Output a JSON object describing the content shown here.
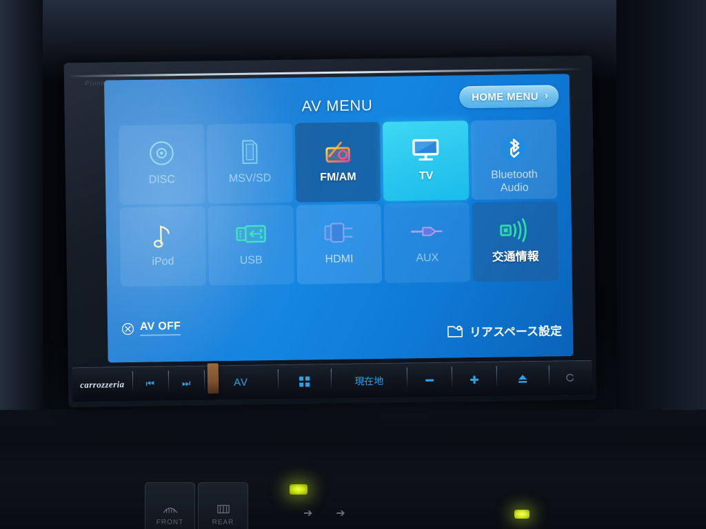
{
  "device": {
    "brand_bezel": "Pioneer",
    "brand_strip": "carrozzeria"
  },
  "screen": {
    "header": {
      "title": "AV MENU",
      "home_menu_label": "HOME MENU",
      "home_menu_arrow": "›"
    },
    "sources": [
      {
        "id": "disc",
        "label": "DISC",
        "icon": "disc-icon",
        "state": "disabled"
      },
      {
        "id": "msv-sd",
        "label": "MSV/SD",
        "icon": "sd-card-icon",
        "state": "disabled"
      },
      {
        "id": "fm-am",
        "label": "FM/AM",
        "icon": "radio-icon",
        "state": "available"
      },
      {
        "id": "tv",
        "label": "TV",
        "icon": "tv-icon",
        "state": "selected"
      },
      {
        "id": "bt-audio",
        "label": "Bluetooth\nAudio",
        "icon": "bluetooth-icon",
        "state": "normal"
      },
      {
        "id": "ipod",
        "label": "iPod",
        "icon": "music-note-icon",
        "state": "disabled"
      },
      {
        "id": "usb",
        "label": "USB",
        "icon": "usb-icon",
        "state": "disabled"
      },
      {
        "id": "hdmi",
        "label": "HDMI",
        "icon": "hdmi-plug-icon",
        "state": "normal"
      },
      {
        "id": "aux",
        "label": "AUX",
        "icon": "aux-jack-icon",
        "state": "disabled"
      },
      {
        "id": "traffic",
        "label": "交通情報",
        "icon": "broadcast-icon",
        "state": "available"
      }
    ],
    "footer": {
      "av_off_label": "AV OFF",
      "av_off_icon": "circle-x-icon",
      "rear_space_label": "リアスペース設定",
      "rear_space_icon": "screen-gear-icon"
    },
    "colors": {
      "bg_start": "#1d74c8",
      "bg_end": "#0a63b8",
      "accent_selected": "#2ec9ef",
      "home_btn": "#8fd2f0",
      "text_primary": "#ffffff",
      "text_dim": "#b8d8f2"
    }
  },
  "hardware_bar": {
    "buttons": [
      {
        "id": "brand",
        "label": "carrozzeria",
        "icon": "brand-logo"
      },
      {
        "id": "prev",
        "label": "",
        "icon": "prev-track-icon"
      },
      {
        "id": "next",
        "label": "",
        "icon": "next-track-icon"
      },
      {
        "id": "av",
        "label": "AV",
        "icon": "av-button"
      },
      {
        "id": "apps",
        "label": "",
        "icon": "grid-apps-icon"
      },
      {
        "id": "current",
        "label": "現在地",
        "icon": "current-location-button"
      },
      {
        "id": "vol-down",
        "label": "−",
        "icon": "volume-down-icon"
      },
      {
        "id": "vol-up",
        "label": "+",
        "icon": "volume-up-icon"
      },
      {
        "id": "eject",
        "label": "",
        "icon": "eject-icon"
      },
      {
        "id": "reset",
        "label": "",
        "icon": "reset-icon"
      }
    ]
  },
  "dashboard": {
    "defroster": [
      {
        "id": "front",
        "label": "FRONT",
        "icon": "front-defrost-icon"
      },
      {
        "id": "rear",
        "label": "REAR",
        "icon": "rear-defrost-icon"
      }
    ]
  }
}
